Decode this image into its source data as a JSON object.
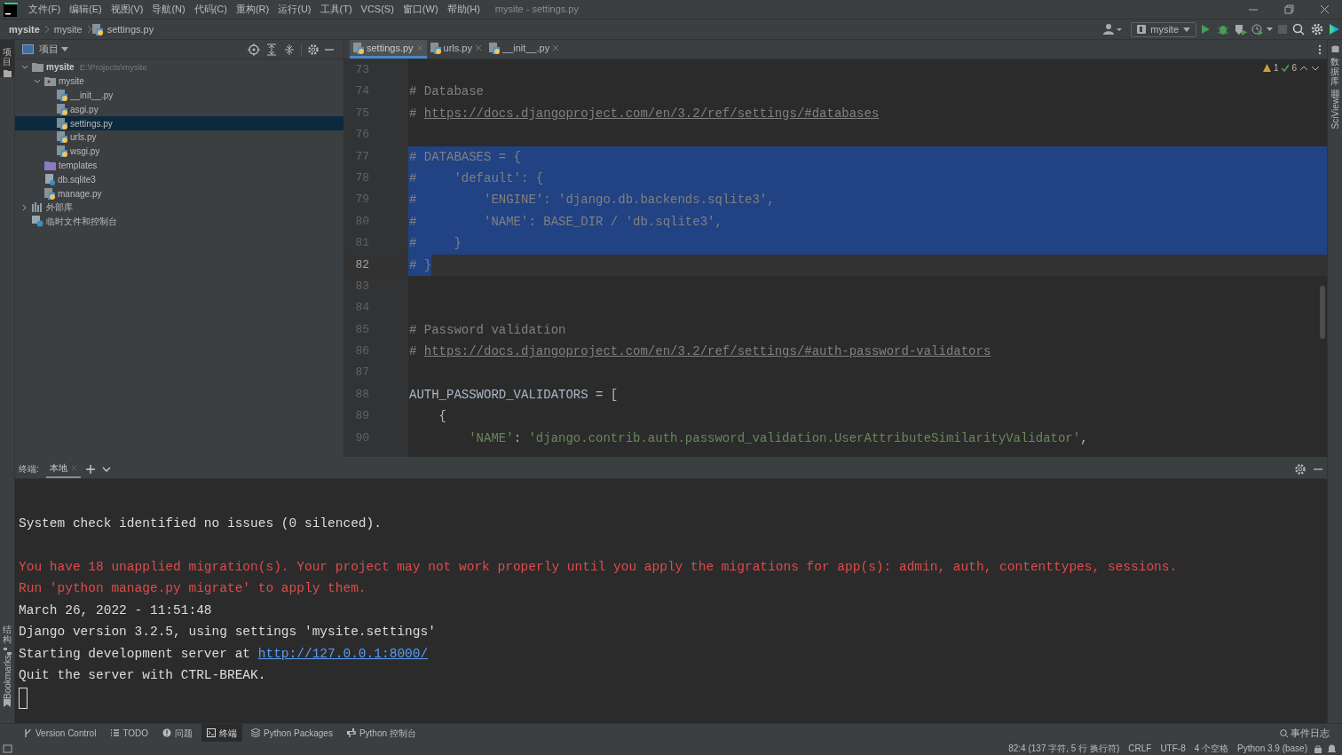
{
  "title_bar": {
    "menu": [
      "文件(F)",
      "编辑(E)",
      "视图(V)",
      "导航(N)",
      "代码(C)",
      "重构(R)",
      "运行(U)",
      "工具(T)",
      "VCS(S)",
      "窗口(W)",
      "帮助(H)"
    ],
    "title": "mysite - settings.py"
  },
  "breadcrumbs": [
    "mysite",
    "mysite",
    "settings.py"
  ],
  "run_config": "mysite",
  "left_strip": [
    "项目",
    "结构",
    "Bookmarks"
  ],
  "right_strip": [
    "数据库",
    "SciView"
  ],
  "project_panel": {
    "title": "项目",
    "tree": [
      {
        "label": "mysite",
        "path": "E:\\Projects\\mysite",
        "kind": "folder",
        "expanded": true,
        "selected": false,
        "children": [
          {
            "label": "mysite",
            "kind": "package",
            "expanded": true,
            "selected": false,
            "children": [
              {
                "label": "__init__.py",
                "kind": "python",
                "selected": false
              },
              {
                "label": "asgi.py",
                "kind": "python",
                "selected": false
              },
              {
                "label": "settings.py",
                "kind": "python",
                "selected": true
              },
              {
                "label": "urls.py",
                "kind": "python",
                "selected": false
              },
              {
                "label": "wsgi.py",
                "kind": "python",
                "selected": false
              }
            ]
          },
          {
            "label": "templates",
            "kind": "templates",
            "selected": false
          },
          {
            "label": "db.sqlite3",
            "kind": "db",
            "selected": false
          },
          {
            "label": "manage.py",
            "kind": "python",
            "selected": false
          }
        ]
      },
      {
        "label": "外部库",
        "kind": "library",
        "expanded": false,
        "selected": false
      },
      {
        "label": "临时文件和控制台",
        "kind": "scratch",
        "selected": false
      }
    ]
  },
  "editor_tabs": [
    {
      "label": "settings.py",
      "selected": true
    },
    {
      "label": "urls.py",
      "selected": false
    },
    {
      "label": "__init__.py",
      "selected": false
    }
  ],
  "inspections": {
    "warnings": "1",
    "ok": "6"
  },
  "code": [
    {
      "n": "73",
      "selected": false,
      "current": false
    },
    {
      "n": "74",
      "selected": false,
      "current": false,
      "segments": [
        {
          "kind": "comment",
          "text": "# Database"
        }
      ]
    },
    {
      "n": "75",
      "selected": false,
      "current": false,
      "segments": [
        {
          "kind": "comment",
          "text": "# "
        },
        {
          "kind": "link",
          "text": "https://docs.djangoproject.com/en/3.2/ref/settings/#databases"
        }
      ]
    },
    {
      "n": "76",
      "selected": false,
      "current": false
    },
    {
      "n": "77",
      "selected": true,
      "current": false,
      "segments": [
        {
          "kind": "comment",
          "text": "# DATABASES = {"
        }
      ]
    },
    {
      "n": "78",
      "selected": true,
      "current": false,
      "segments": [
        {
          "kind": "comment",
          "text": "#     'default': {"
        }
      ]
    },
    {
      "n": "79",
      "selected": true,
      "current": false,
      "segments": [
        {
          "kind": "comment",
          "text": "#         'ENGINE': 'django.db.backends.sqlite3',"
        }
      ]
    },
    {
      "n": "80",
      "selected": true,
      "current": false,
      "segments": [
        {
          "kind": "comment",
          "text": "#         'NAME': BASE_DIR / 'db.sqlite3',"
        }
      ]
    },
    {
      "n": "81",
      "selected": true,
      "current": false,
      "segments": [
        {
          "kind": "comment",
          "text": "#     }"
        }
      ]
    },
    {
      "n": "82",
      "selected": true,
      "current": true,
      "segments": [
        {
          "kind": "comment",
          "text": "# }"
        }
      ]
    },
    {
      "n": "83",
      "selected": false,
      "current": false
    },
    {
      "n": "84",
      "selected": false,
      "current": false
    },
    {
      "n": "85",
      "selected": false,
      "current": false,
      "segments": [
        {
          "kind": "comment",
          "text": "# Password validation"
        }
      ]
    },
    {
      "n": "86",
      "selected": false,
      "current": false,
      "segments": [
        {
          "kind": "comment",
          "text": "# "
        },
        {
          "kind": "link",
          "text": "https://docs.djangoproject.com/en/3.2/ref/settings/#auth-password-validators"
        }
      ]
    },
    {
      "n": "87",
      "selected": false,
      "current": false
    },
    {
      "n": "88",
      "selected": false,
      "current": false,
      "segments": [
        {
          "kind": "plain",
          "text": "AUTH_PASSWORD_VALIDATORS = ["
        }
      ]
    },
    {
      "n": "89",
      "selected": false,
      "current": false,
      "segments": [
        {
          "kind": "plain",
          "text": "    {"
        }
      ]
    },
    {
      "n": "90",
      "selected": false,
      "current": false,
      "segments": [
        {
          "kind": "string",
          "text": "        'NAME'"
        },
        {
          "kind": "plain",
          "text": ": "
        },
        {
          "kind": "string",
          "text": "'django.contrib.auth.password_validation.UserAttributeSimilarityValidator'"
        },
        {
          "kind": "plain",
          "text": ","
        }
      ]
    }
  ],
  "terminal": {
    "label": "终端:",
    "tabs": [
      {
        "label": "本地",
        "selected": true
      }
    ],
    "lines": [
      {
        "space_before": true,
        "segments": [
          {
            "kind": "plain",
            "text": "System check identified no issues (0 silenced)."
          }
        ]
      },
      {
        "space_before": true,
        "segments": [
          {
            "kind": "error",
            "text": "You have 18 unapplied migration(s). Your project may not work properly until you apply the migrations for app(s): admin, auth, contenttypes, sessions."
          }
        ]
      },
      {
        "segments": [
          {
            "kind": "error",
            "text": "Run 'python manage.py migrate' to apply them."
          }
        ]
      },
      {
        "segments": [
          {
            "kind": "plain",
            "text": "March 26, 2022 - 11:51:48"
          }
        ]
      },
      {
        "segments": [
          {
            "kind": "plain",
            "text": "Django version 3.2.5, using settings 'mysite.settings'"
          }
        ]
      },
      {
        "segments": [
          {
            "kind": "plain",
            "text": "Starting development server at "
          },
          {
            "kind": "link",
            "text": "http://127.0.0.1:8000/"
          }
        ]
      },
      {
        "segments": [
          {
            "kind": "plain",
            "text": "Quit the server with CTRL-BREAK."
          }
        ]
      }
    ]
  },
  "tool_tabs": [
    {
      "label": "Version Control",
      "selected": false
    },
    {
      "label": "TODO",
      "selected": false
    },
    {
      "label": "问题",
      "selected": false
    },
    {
      "label": "终端",
      "selected": true
    },
    {
      "label": "Python Packages",
      "selected": false
    },
    {
      "label": "Python 控制台",
      "selected": false
    }
  ],
  "event_log": "事件日志",
  "status_bar": [
    "82:4 (137 字符, 5 行 换行符)",
    "CRLF",
    "UTF-8",
    "4 个空格",
    "Python 3.9 (base)"
  ]
}
